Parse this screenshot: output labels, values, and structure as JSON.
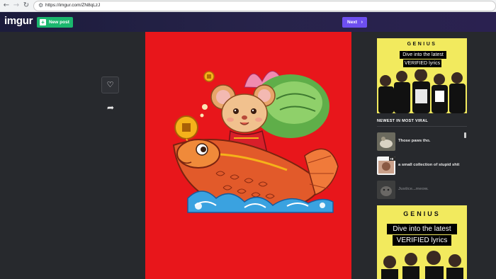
{
  "browser": {
    "url": "https://imgur.com/ZN8qLzJ",
    "back_icon": "arrow-left-icon",
    "forward_icon": "arrow-right-icon",
    "reload_icon": "reload-icon"
  },
  "header": {
    "logo": "imgur",
    "new_post_label": "New post",
    "next_label": "Next"
  },
  "post_actions": {
    "like_icon": "heart-icon",
    "share_icon": "share-arrow-icon"
  },
  "sidebar": {
    "ad_top": {
      "brand": "GENIUS",
      "line1": "Dive into the latest",
      "line2": "VERIFIED lyrics"
    },
    "section_title": "NEWEST IN MOST VIRAL",
    "viral_items": [
      {
        "title": "Those paws tho."
      },
      {
        "title": "a small collection of stupid shit",
        "badge": "+8"
      },
      {
        "title": "Justice...meow."
      }
    ],
    "ad_bottom": {
      "brand": "GENIUS",
      "line1": "Dive into the latest",
      "line2": "VERIFIED lyrics"
    }
  },
  "colors": {
    "page_bg": "#27292d",
    "topbar": "#1c1c3c",
    "new_post_green": "#1bb76e",
    "next_purple": "#6e4ff0",
    "image_red": "#e8161b",
    "ad_yellow": "#f2ea5e"
  }
}
